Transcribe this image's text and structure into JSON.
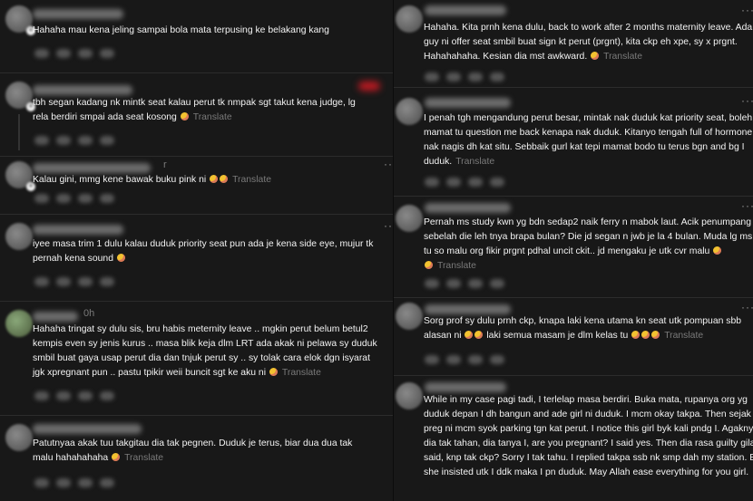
{
  "left_posts": [
    {
      "time": "",
      "lines": [
        "Hahaha mau kena jeling sampai bola mata terpusing ke belakang kang"
      ],
      "emoji_count": 0,
      "translate": ""
    },
    {
      "time": "",
      "lines": [
        "tbh segan kadang nk mintk seat kalau perut tk nmpak sgt takut kena judge, lg",
        "rela berdiri smpai ada seat kosong"
      ],
      "emoji_count": 1,
      "translate": "Translate"
    },
    {
      "time": "r",
      "lines": [
        "Kalau gini, mmg kene bawak buku pink ni"
      ],
      "emoji_count": 2,
      "translate": "Translate"
    },
    {
      "time": "",
      "lines": [
        "iyee masa trim 1 dulu kalau duduk priority seat pun ada je kena side eye, mujur tk",
        "pernah kena sound"
      ],
      "emoji_count": 1,
      "translate": ""
    },
    {
      "time": "0h",
      "lines": [
        "Hahaha tringat sy dulu sis, bru habis meternity leave .. mgkin perut belum betul2",
        "kempis even sy jenis kurus .. masa blik keja dlm LRT ada akak ni pelawa sy duduk",
        "smbil buat gaya usap perut dia dan tnjuk perut sy .. sy tolak cara elok dgn isyarat",
        "jgk xpregnant pun .. pastu tpikir weii buncit sgt ke aku ni"
      ],
      "emoji_count": 1,
      "translate": "Translate"
    },
    {
      "time": "",
      "lines": [
        "Patutnyaa akak tuu takgitau dia tak pegnen. Duduk je terus, biar dua dua tak",
        "malu hahahahaha"
      ],
      "emoji_count": 1,
      "translate": "Translate"
    }
  ],
  "right_posts": [
    {
      "lines": [
        "Hahaha. Kita prnh kena dulu, back to work after 2 months maternity leave. Ada 1",
        "guy ni offer seat smbil buat sign kt perut (prgnt), kita ckp eh xpe, sy x prgnt.",
        "Hahahahaha. Kesian dia mst awkward."
      ],
      "emoji_count": 1,
      "translate": "Translate"
    },
    {
      "lines": [
        "I penah tgh mengandung perut besar, mintak nak duduk kat priority seat, boleh",
        "mamat tu question me back kenapa nak duduk. Kitanyo tengah full of hormone,",
        "nak nagis dh kat situ. Sebbaik gurl kat tepi mamat bodo tu terus bgn and bg I",
        "duduk."
      ],
      "emoji_count": 0,
      "translate": "Translate"
    },
    {
      "lines": [
        "Pernah ms study kwn yg bdn sedap2 naik ferry n mabok laut. Acik penumpang",
        "sebelah die leh tnya brapa bulan? Die jd segan n jwb je la 4 bulan. Muda lg ms",
        "tu so malu org fikir prgnt pdhal uncit ckit.. jd mengaku je utk cvr malu",
        ""
      ],
      "emoji_count": 2,
      "translate": "Translate"
    },
    {
      "lines": [
        "Sorg prof sy dulu prnh ckp, knapa laki kena utama kn seat utk pompuan sbb",
        "alasan ni"
      ],
      "mid_text": "laki semua masam je dlm kelas tu",
      "emoji_count": 5,
      "translate": "Translate"
    },
    {
      "lines": [
        "While in my case pagi tadi, I terlelap masa berdiri. Buka mata, rupanya org yg",
        "duduk depan I dh bangun and ade girl ni duduk. I mcm okay takpa. Then sejak",
        "preg ni mcm syok parking tgn kat perut. I notice this girl byk kali pndg I. Agaknya",
        "dia tak tahan, dia tanya I, are you pregnant? I said yes. Then dia rasa guilty gila &",
        "said, knp tak ckp? Sorry I tak tahu. I replied takpa ssb nk smp dah my station. But",
        "she insisted utk I ddk maka I pn duduk. May Allah ease everything for you girl."
      ],
      "emoji_count": 0,
      "translate": ""
    }
  ],
  "icons": {
    "more": "more-options-icon",
    "emoji": "laughing-emoji-icon",
    "follow": "follow-plus-icon"
  },
  "colors": {
    "background": "#181818",
    "text": "#f3f3f3",
    "muted": "#7a7a7a"
  }
}
